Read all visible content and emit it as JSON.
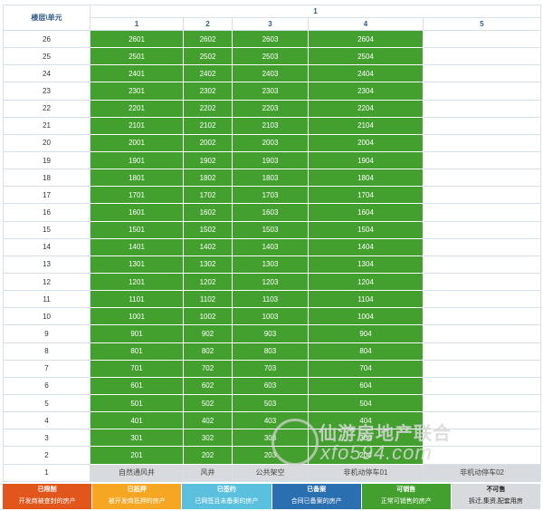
{
  "header": {
    "corner_label": "楼层\\单元",
    "building_label": "1",
    "units": [
      "1",
      "2",
      "3",
      "4",
      "5"
    ]
  },
  "floors": [
    {
      "floor": "26",
      "rooms": [
        "2601",
        "2602",
        "2603",
        "2604"
      ]
    },
    {
      "floor": "25",
      "rooms": [
        "2501",
        "2502",
        "2503",
        "2504"
      ]
    },
    {
      "floor": "24",
      "rooms": [
        "2401",
        "2402",
        "2403",
        "2404"
      ]
    },
    {
      "floor": "23",
      "rooms": [
        "2301",
        "2302",
        "2303",
        "2304"
      ]
    },
    {
      "floor": "22",
      "rooms": [
        "2201",
        "2202",
        "2203",
        "2204"
      ]
    },
    {
      "floor": "21",
      "rooms": [
        "2101",
        "2102",
        "2103",
        "2104"
      ]
    },
    {
      "floor": "20",
      "rooms": [
        "2001",
        "2002",
        "2003",
        "2004"
      ]
    },
    {
      "floor": "19",
      "rooms": [
        "1901",
        "1902",
        "1903",
        "1904"
      ]
    },
    {
      "floor": "18",
      "rooms": [
        "1801",
        "1802",
        "1803",
        "1804"
      ]
    },
    {
      "floor": "17",
      "rooms": [
        "1701",
        "1702",
        "1703",
        "1704"
      ]
    },
    {
      "floor": "16",
      "rooms": [
        "1601",
        "1602",
        "1603",
        "1604"
      ]
    },
    {
      "floor": "15",
      "rooms": [
        "1501",
        "1502",
        "1503",
        "1504"
      ]
    },
    {
      "floor": "14",
      "rooms": [
        "1401",
        "1402",
        "1403",
        "1404"
      ]
    },
    {
      "floor": "13",
      "rooms": [
        "1301",
        "1302",
        "1303",
        "1304"
      ]
    },
    {
      "floor": "12",
      "rooms": [
        "1201",
        "1202",
        "1203",
        "1204"
      ]
    },
    {
      "floor": "11",
      "rooms": [
        "1101",
        "1102",
        "1103",
        "1104"
      ]
    },
    {
      "floor": "10",
      "rooms": [
        "1001",
        "1002",
        "1003",
        "1004"
      ]
    },
    {
      "floor": "9",
      "rooms": [
        "901",
        "902",
        "903",
        "904"
      ]
    },
    {
      "floor": "8",
      "rooms": [
        "801",
        "802",
        "803",
        "804"
      ]
    },
    {
      "floor": "7",
      "rooms": [
        "701",
        "702",
        "703",
        "704"
      ]
    },
    {
      "floor": "6",
      "rooms": [
        "601",
        "602",
        "603",
        "604"
      ]
    },
    {
      "floor": "5",
      "rooms": [
        "501",
        "502",
        "503",
        "504"
      ]
    },
    {
      "floor": "4",
      "rooms": [
        "401",
        "402",
        "403",
        "404"
      ]
    },
    {
      "floor": "3",
      "rooms": [
        "301",
        "302",
        "303",
        "304"
      ]
    },
    {
      "floor": "2",
      "rooms": [
        "201",
        "202",
        "203",
        "204"
      ]
    }
  ],
  "ground_floor": {
    "floor": "1",
    "cells": [
      "自然通风井",
      "风井",
      "公共架空",
      "非机动停车01",
      "非机动停车02"
    ]
  },
  "legend": [
    {
      "title": "已限制",
      "desc": "开发商被查封的房产",
      "color": "#e0561b"
    },
    {
      "title": "已抵押",
      "desc": "被开发商抵押的房产",
      "color": "#f5a623"
    },
    {
      "title": "已签约",
      "desc": "已网签且未备案的房产",
      "color": "#5bc0de"
    },
    {
      "title": "已备案",
      "desc": "合同已备案的房产",
      "color": "#2a6fb0"
    },
    {
      "title": "可销售",
      "desc": "正常可销售的房产",
      "color": "#43a02e"
    },
    {
      "title": "不可售",
      "desc": "拆迁,集资,配套用房",
      "color": "#d8dbde"
    }
  ],
  "watermark": {
    "line1": "仙游房地产联合",
    "line2": "xfo594.com"
  }
}
